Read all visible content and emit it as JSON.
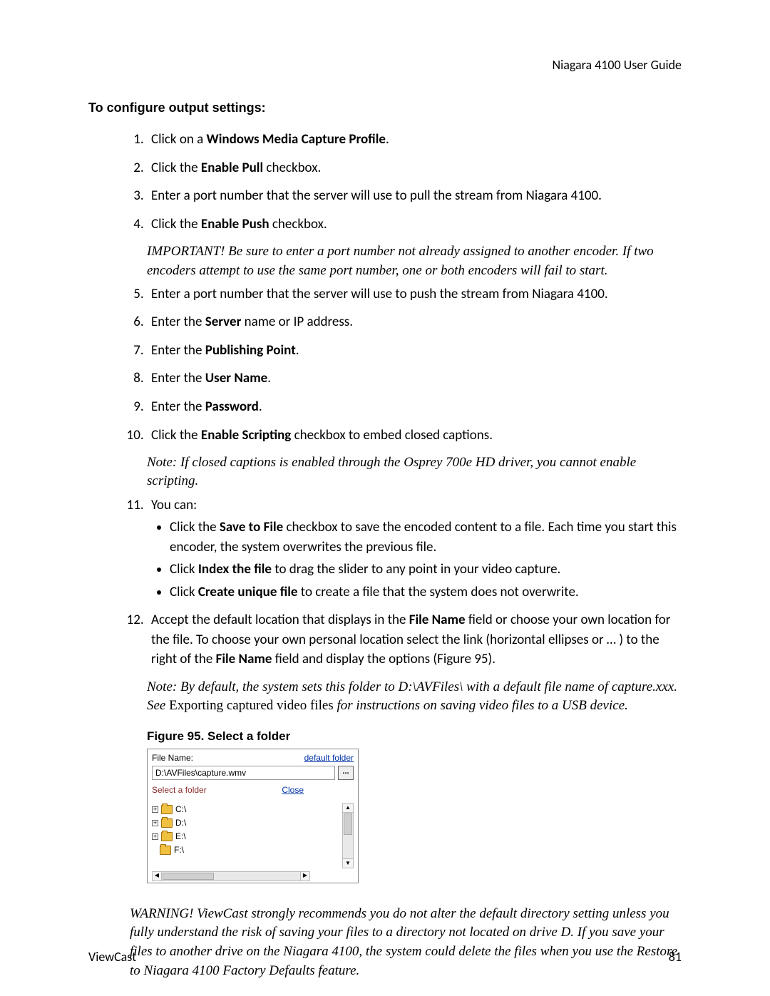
{
  "header": {
    "title": "Niagara 4100 User Guide"
  },
  "section_title": "To configure output settings:",
  "steps": {
    "s1_pre": "Click on a ",
    "s1_bold": "Windows Media Capture Profile",
    "s1_post": ".",
    "s2_pre": "Click the ",
    "s2_bold": "Enable Pull",
    "s2_post": " checkbox.",
    "s3": "Enter a port number that the server will use to pull the stream from Niagara 4100.",
    "s4_pre": "Click the ",
    "s4_bold": "Enable Push",
    "s4_post": " checkbox.",
    "s5": "Enter a port number that the server will use to push the stream from Niagara 4100.",
    "s6_pre": "Enter the ",
    "s6_bold": "Server",
    "s6_post": " name or IP address.",
    "s7_pre": "Enter the ",
    "s7_bold": "Publishing Point",
    "s7_post": ".",
    "s8_pre": "Enter the ",
    "s8_bold": "User Name",
    "s8_post": ".",
    "s9_pre": "Enter the ",
    "s9_bold": "Password",
    "s9_post": ".",
    "s10_pre": "Click the ",
    "s10_bold": "Enable Scripting",
    "s10_post": " checkbox to embed closed captions.",
    "s11": "You can:",
    "s12_a": "Accept the default location that displays in the ",
    "s12_bold1": "File Name",
    "s12_b": " field or choose your own location for the file. To choose your own personal location select the link (horizontal ellipses or … ) to the right of the ",
    "s12_bold2": "File Name",
    "s12_c": " field and display the options (Figure 95)."
  },
  "bullets": {
    "b1_pre": "Click the ",
    "b1_bold": "Save to File",
    "b1_post": " checkbox to save the encoded content to a file. Each time you start this encoder, the system overwrites the previous file.",
    "b2_pre": "Click ",
    "b2_bold": "Index the file",
    "b2_post": " to drag the slider to any point in your video capture.",
    "b3_pre": "Click ",
    "b3_bold": "Create unique file",
    "b3_post": " to create a file that the system does not overwrite."
  },
  "notes": {
    "important": "IMPORTANT! Be sure to enter a port number not already assigned to another encoder. If two encoders attempt to use the same port number, one or both encoders will fail to start.",
    "scripting": "Note: If closed captions is enabled through the Osprey 700e HD driver, you cannot enable scripting.",
    "default_folder_a": "Note: By default, the system sets this folder to D:\\AVFiles\\ with a default file name of capture.xxx. See ",
    "default_folder_noital": "Exporting captured video files",
    "default_folder_b": " for instructions on saving video files to a USB device."
  },
  "figure": {
    "caption": "Figure 95. Select a folder",
    "file_name_label": "File Name:",
    "default_folder_link": "default folder",
    "file_name_value": "D:\\AVFiles\\capture.wmv",
    "ellipsis_label": "...",
    "select_folder_label": "Select a folder",
    "close_link": "Close",
    "drives": [
      "C:\\",
      "D:\\",
      "E:\\",
      "F:\\"
    ]
  },
  "warning": "WARNING!  ViewCast strongly recommends you do not alter the default directory setting unless you fully understand the risk of saving your files to a directory not located on drive D. If you save your files to another drive on the Niagara 4100, the system could delete the files when you use the Restore to Niagara 4100 Factory Defaults feature.",
  "footer": {
    "left": "ViewCast",
    "right": "81"
  }
}
